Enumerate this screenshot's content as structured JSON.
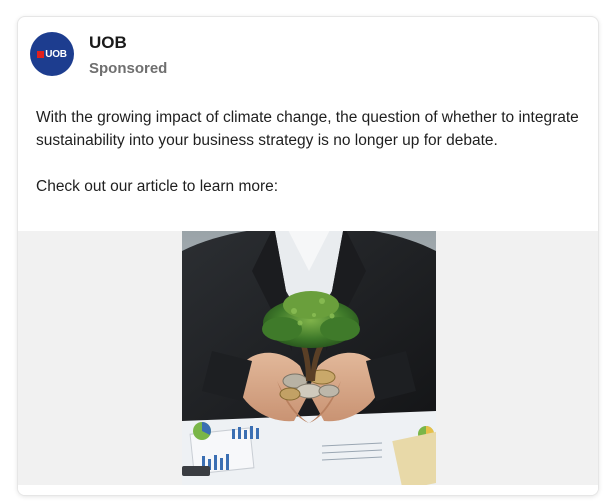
{
  "post": {
    "advertiser": "UOB",
    "avatar_text": "UOB",
    "sponsored_label": "Sponsored",
    "body_paragraph_1": "With the growing impact of climate change, the question of whether to integrate sustainability into your business strategy is no longer up for debate.",
    "body_paragraph_2": "Check out our article to learn more:",
    "image_subject": "hands-holding-coins-with-small-tree"
  },
  "colors": {
    "avatar_bg": "#1d3d8f",
    "logo_mark": "#e3201c",
    "media_bg": "#f1f1f1"
  }
}
